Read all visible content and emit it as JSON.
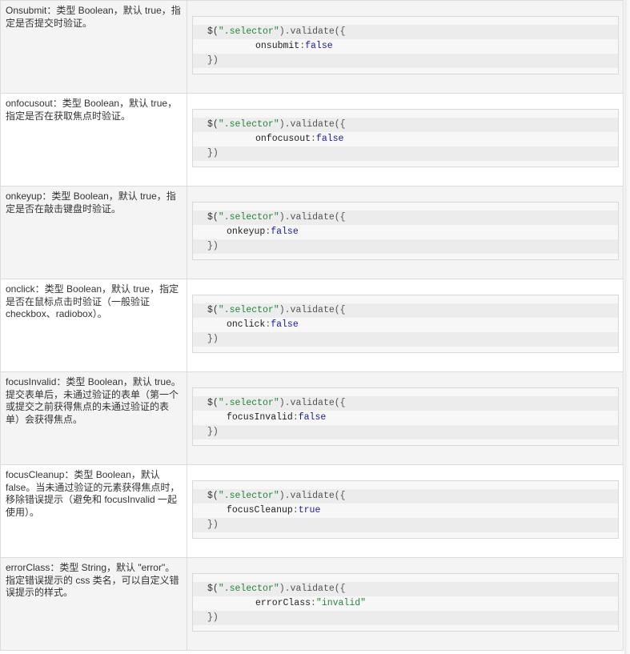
{
  "rows": [
    {
      "description": "Onsubmit：类型 Boolean，默认 true，指定是否提交时验证。",
      "code": {
        "prefix": "$(",
        "selector": "\".selector\"",
        "call": ").validate({",
        "key": "onsubmit",
        "colon": ":",
        "value": "false",
        "close": "})"
      }
    },
    {
      "description": "onfocusout：类型 Boolean，默认 true，指定是否在获取焦点时验证。",
      "code": {
        "prefix": "$(",
        "selector": "\".selector\"",
        "call": ").validate({",
        "key": "onfocusout",
        "colon": ":",
        "value": "false",
        "close": "})"
      }
    },
    {
      "description": "onkeyup：类型 Boolean，默认 true，指定是否在敲击键盘时验证。",
      "code": {
        "prefix": "$(",
        "selector": "\".selector\"",
        "call": ").validate({",
        "key": "onkeyup",
        "colon": ":",
        "value": "false",
        "close": "})"
      }
    },
    {
      "description": "onclick：类型 Boolean，默认 true，指定是否在鼠标点击时验证（一般验证 checkbox、radiobox）。",
      "code": {
        "prefix": "$(",
        "selector": "\".selector\"",
        "call": ").validate({",
        "key": "onclick",
        "colon": ":",
        "value": "false",
        "close": "})"
      }
    },
    {
      "description": "focusInvalid：类型 Boolean，默认 true。提交表单后，未通过验证的表单（第一个或提交之前获得焦点的未通过验证的表单）会获得焦点。",
      "code": {
        "prefix": "$(",
        "selector": "\".selector\"",
        "call": ").validate({",
        "key": "focusInvalid",
        "colon": ":",
        "value": "false",
        "close": "})"
      }
    },
    {
      "description": "focusCleanup：类型 Boolean，默认 false。当未通过验证的元素获得焦点时，移除错误提示（避免和 focusInvalid 一起使用）。",
      "code": {
        "prefix": "$(",
        "selector": "\".selector\"",
        "call": ").validate({",
        "key": "focusCleanup",
        "colon": ":",
        "value": "true",
        "close": "})"
      }
    },
    {
      "description": "errorClass：类型 String，默认 \"error\"。指定错误提示的 css 类名，可以自定义错误提示的样式。",
      "code": {
        "prefix": "$(",
        "selector": "\".selector\"",
        "call": ").validate({",
        "key": "errorClass",
        "colon": ":",
        "value": "\"invalid\"",
        "close": "})"
      }
    }
  ]
}
